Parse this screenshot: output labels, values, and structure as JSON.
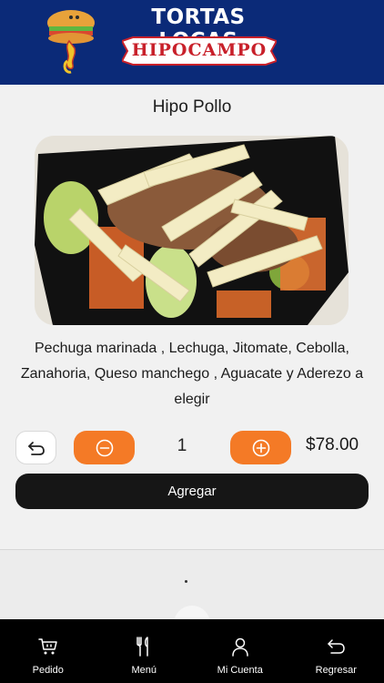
{
  "header": {
    "brand_title": "TORTAS LOCAS",
    "brand_subtitle": "HIPOCAMPO",
    "brand_tm": "MR"
  },
  "product": {
    "title": "Hipo Pollo",
    "description": "Pechuga marinada , Lechuga, Jitomate, Cebolla, Zanahoria, Queso manchego , Aguacate y Aderezo a elegir",
    "quantity": "1",
    "price": "$78.00",
    "add_label": "Agregar"
  },
  "icons": {
    "undo": "undo-arrow-icon",
    "minus": "minus-circle-icon",
    "plus": "plus-circle-icon"
  },
  "nav": {
    "items": [
      {
        "label": "Pedido",
        "icon": "cart-icon"
      },
      {
        "label": "Menú",
        "icon": "utensils-icon"
      },
      {
        "label": "Mi Cuenta",
        "icon": "user-icon"
      },
      {
        "label": "Regresar",
        "icon": "return-arrow-icon"
      }
    ]
  },
  "colors": {
    "header_bg": "#0b2a78",
    "accent_orange": "#f47a26",
    "button_dark": "#161616",
    "nav_bg": "#000000"
  }
}
